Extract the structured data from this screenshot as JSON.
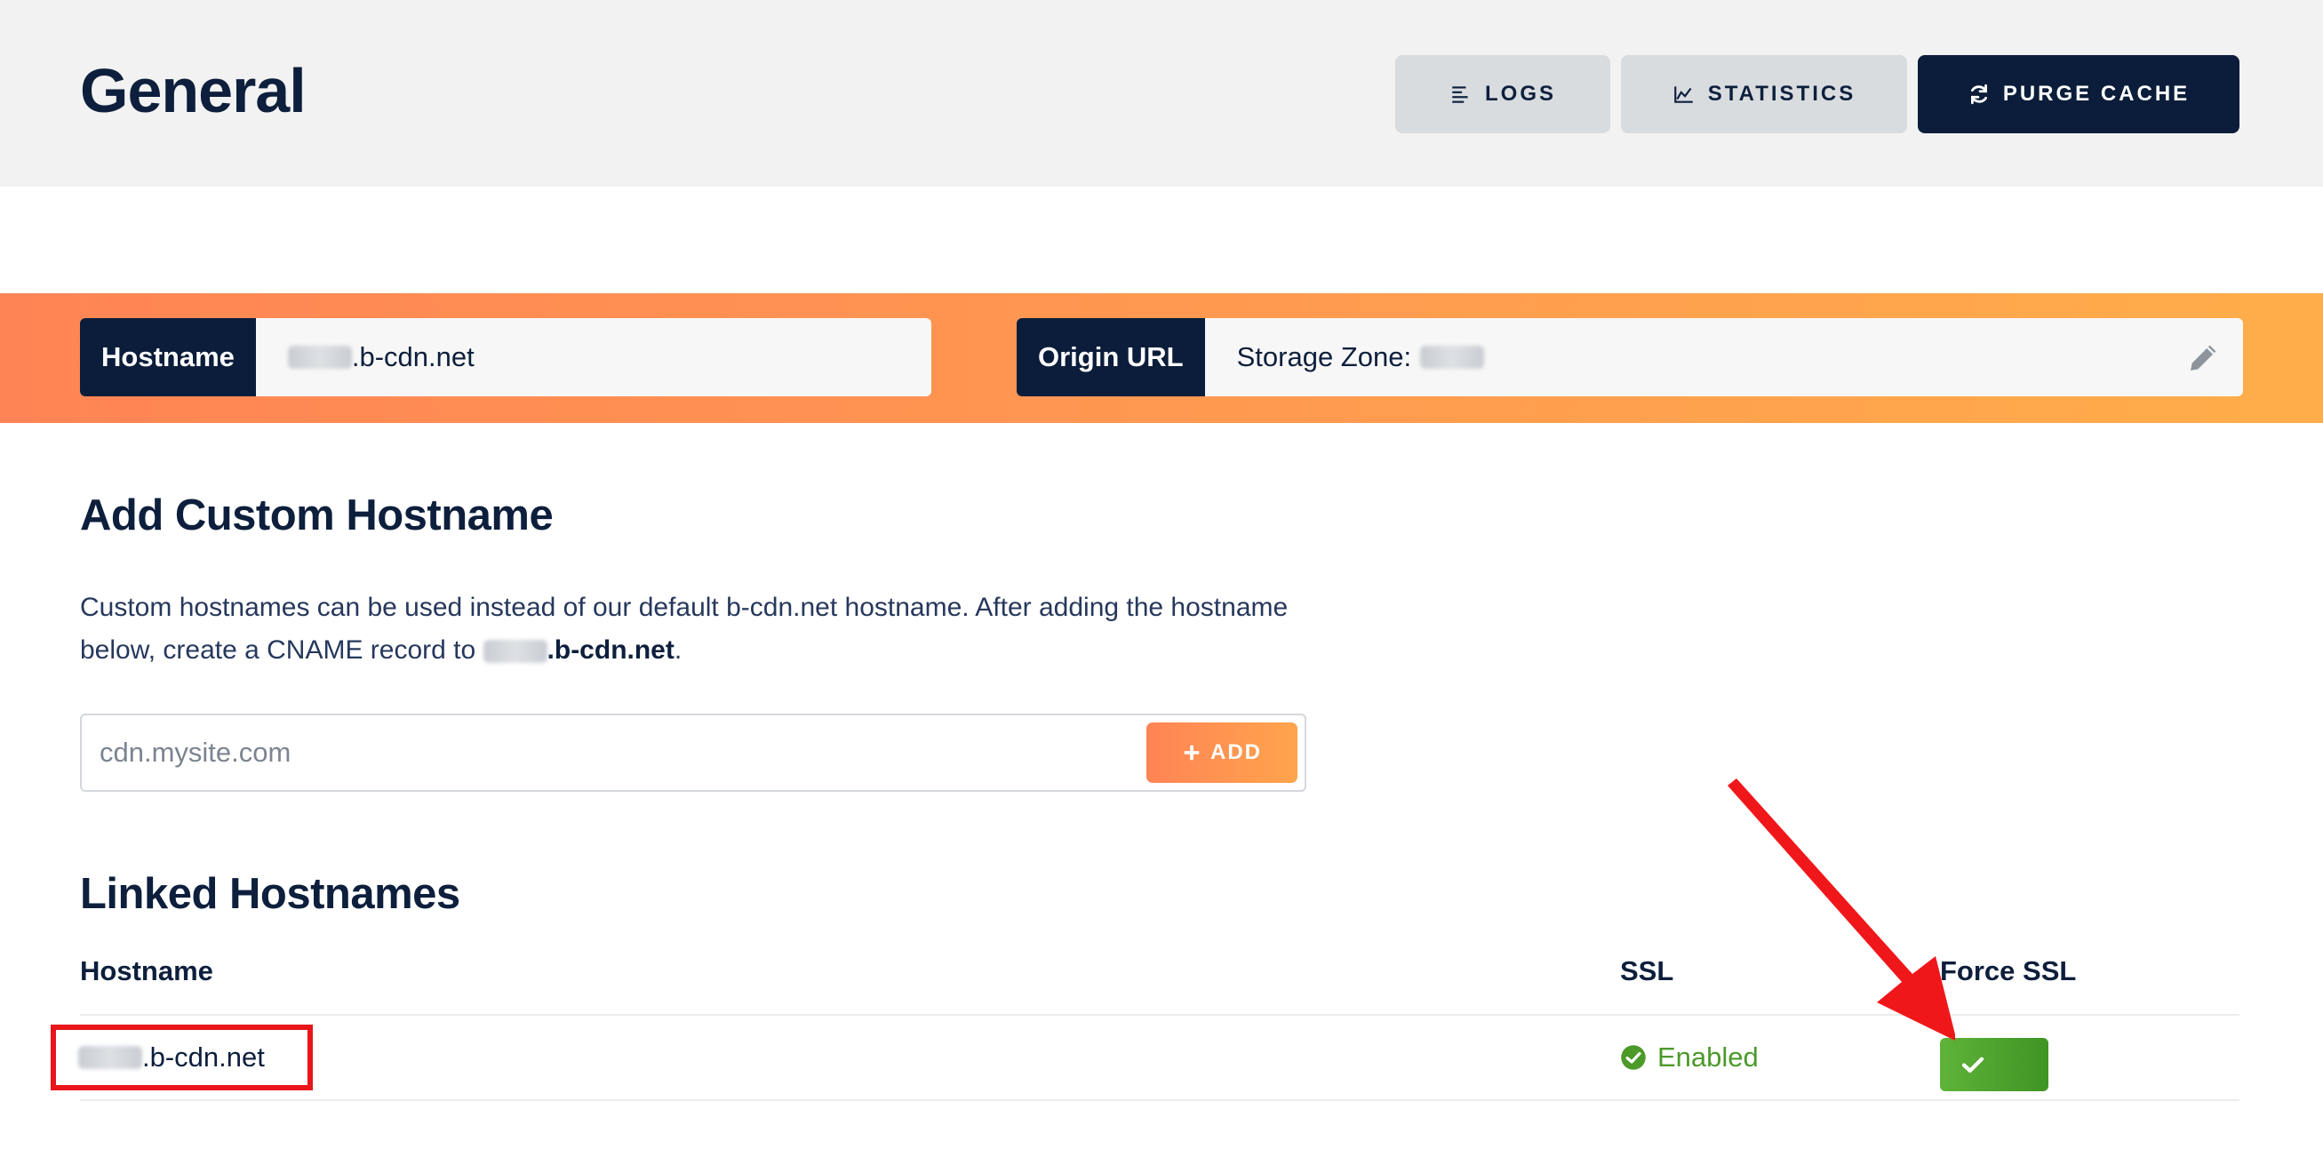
{
  "header": {
    "title": "General",
    "buttons": {
      "logs": "LOGS",
      "statistics": "STATISTICS",
      "purge_cache": "PURGE CACHE"
    }
  },
  "band": {
    "hostname_label": "Hostname",
    "hostname_value": ".b-cdn.net",
    "origin_label": "Origin URL",
    "origin_value": "Storage Zone:"
  },
  "custom_hostname": {
    "title": "Add Custom Hostname",
    "description_1": "Custom hostnames can be used instead of our default b-cdn.net hostname. After adding the hostname below, create a CNAME record to ",
    "description_host": ".b-cdn.net",
    "description_end": ".",
    "input_placeholder": "cdn.mysite.com",
    "add_label": "ADD"
  },
  "linked": {
    "title": "Linked Hostnames",
    "columns": {
      "hostname": "Hostname",
      "ssl": "SSL",
      "force_ssl": "Force SSL"
    },
    "rows": [
      {
        "hostname": ".b-cdn.net",
        "ssl": "Enabled",
        "force_ssl": true
      }
    ]
  },
  "colors": {
    "navy": "#0b1d3a",
    "orange_start": "#ff8455",
    "orange_end": "#ffad4a",
    "green": "#4c9a2a",
    "annotation_red": "#e8151b"
  }
}
